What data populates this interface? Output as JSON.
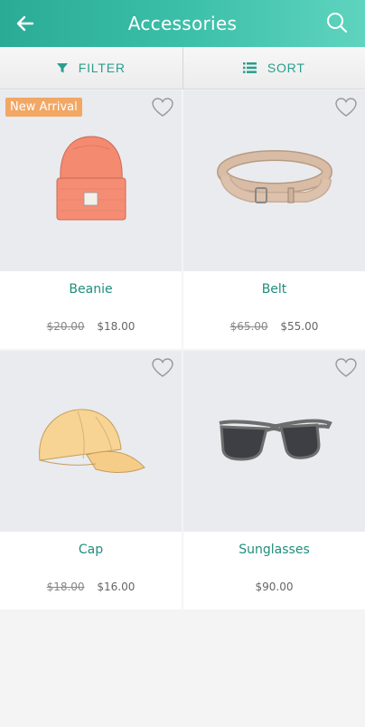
{
  "header": {
    "title": "Accessories"
  },
  "toolbar": {
    "filter_label": "FILTER",
    "sort_label": "SORT"
  },
  "colors": {
    "accent": "#2aab96",
    "badge": "#f2a765",
    "product_name": "#1f8e7c"
  },
  "products": [
    {
      "name": "Beanie",
      "old_price": "$20.00",
      "price": "$18.00",
      "badge": "New Arrival",
      "icon": "beanie-illustration"
    },
    {
      "name": "Belt",
      "old_price": "$65.00",
      "price": "$55.00",
      "icon": "belt-illustration"
    },
    {
      "name": "Cap",
      "old_price": "$18.00",
      "price": "$16.00",
      "icon": "cap-illustration"
    },
    {
      "name": "Sunglasses",
      "price": "$90.00",
      "icon": "sunglasses-illustration"
    }
  ]
}
